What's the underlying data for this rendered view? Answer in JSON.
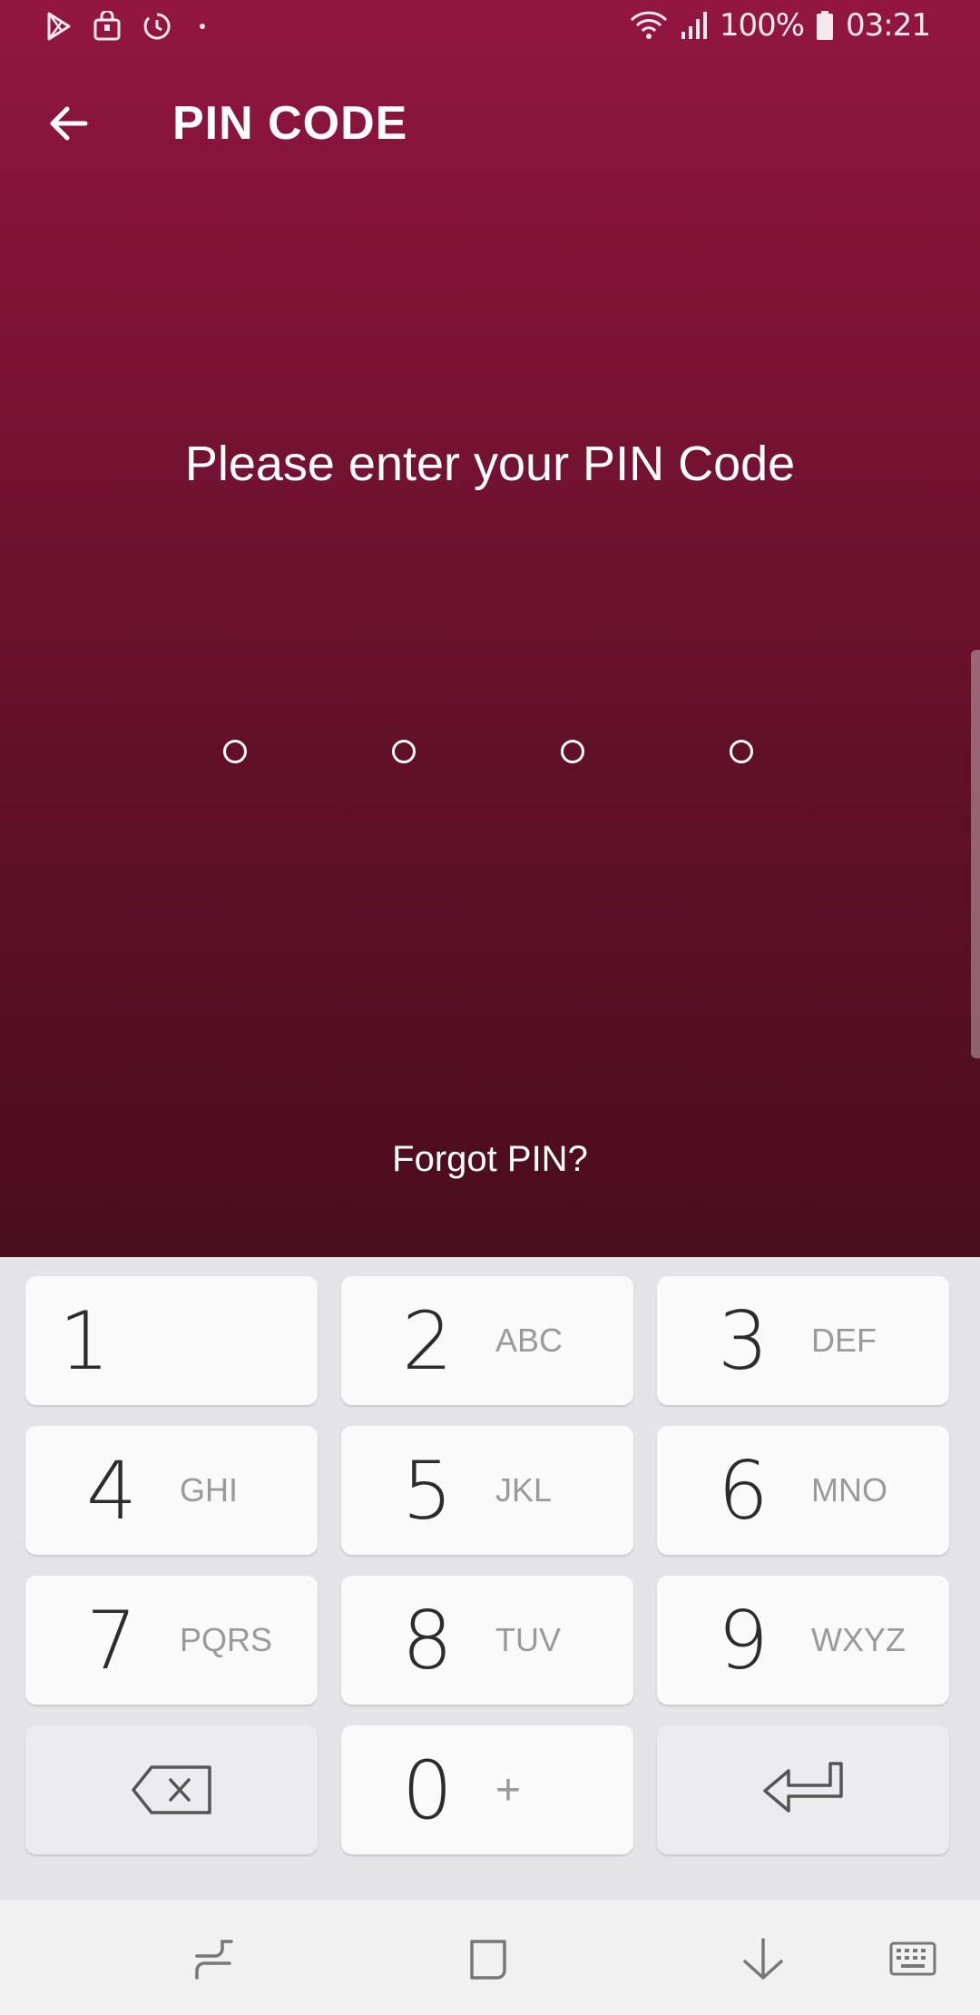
{
  "status_bar": {
    "battery": "100%",
    "time": "03:21",
    "icons": [
      "play-store-icon",
      "shopping-bag-icon",
      "timer-icon",
      "wifi-icon",
      "signal-icon",
      "battery-icon"
    ]
  },
  "header": {
    "title": "PIN CODE",
    "back_icon": "arrow-left-icon"
  },
  "prompt": "Please enter your PIN Code",
  "pin": {
    "length": 4,
    "filled": 0
  },
  "forgot_link": "Forgot PIN?",
  "keypad": {
    "keys": [
      {
        "digit": "1",
        "letters": ""
      },
      {
        "digit": "2",
        "letters": "ABC"
      },
      {
        "digit": "3",
        "letters": "DEF"
      },
      {
        "digit": "4",
        "letters": "GHI"
      },
      {
        "digit": "5",
        "letters": "JKL"
      },
      {
        "digit": "6",
        "letters": "MNO"
      },
      {
        "digit": "7",
        "letters": "PQRS"
      },
      {
        "digit": "8",
        "letters": "TUV"
      },
      {
        "digit": "9",
        "letters": "WXYZ"
      },
      {
        "digit": "0",
        "letters": "+"
      }
    ],
    "backspace_icon": "backspace-icon",
    "enter_icon": "enter-icon"
  },
  "nav_bar": {
    "icons": [
      "recent-apps-icon",
      "home-icon",
      "back-down-icon",
      "keyboard-icon"
    ]
  },
  "colors": {
    "app_gradient_top": "#921640",
    "app_gradient_bottom": "#4a0e1d",
    "keypad_bg": "#e4e4e7",
    "key_bg": "#fafafa"
  }
}
